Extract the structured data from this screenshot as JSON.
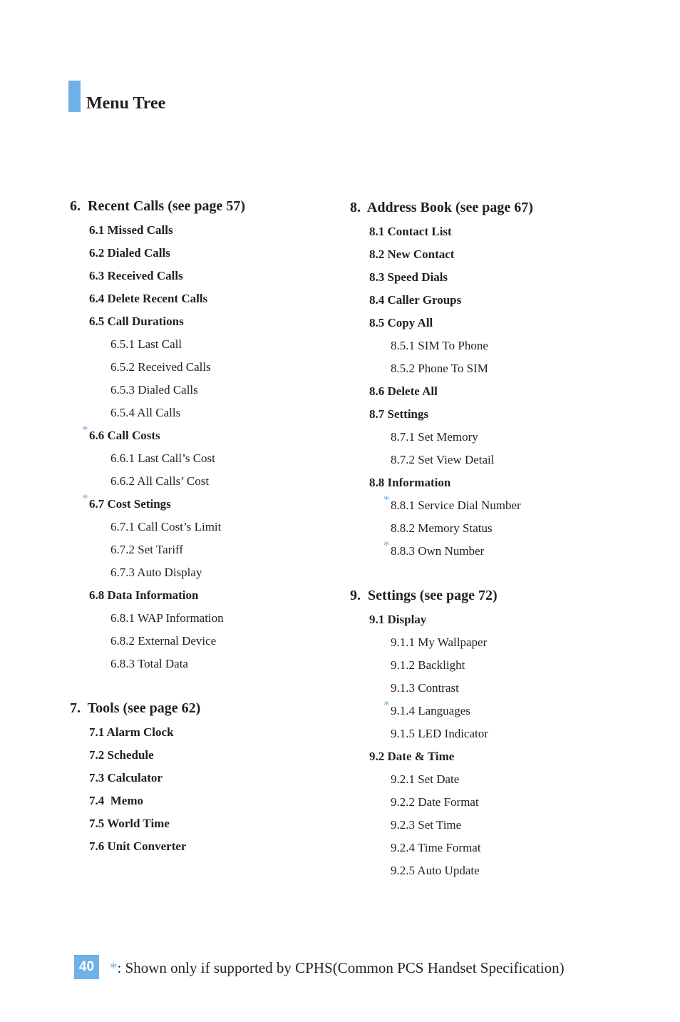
{
  "title": "Menu Tree",
  "colors": {
    "accent": "#6fb0e6",
    "text": "#231f20"
  },
  "left": {
    "s6": {
      "heading": "6.  Recent Calls (see page 57)",
      "items": [
        {
          "label": "6.1 Missed Calls",
          "level": 1,
          "cphs": false
        },
        {
          "label": "6.2 Dialed Calls",
          "level": 1,
          "cphs": false
        },
        {
          "label": "6.3 Received Calls",
          "level": 1,
          "cphs": false
        },
        {
          "label": "6.4 Delete Recent Calls",
          "level": 1,
          "cphs": false
        },
        {
          "label": "6.5 Call Durations",
          "level": 1,
          "cphs": false
        },
        {
          "label": "6.5.1 Last Call",
          "level": 2,
          "cphs": false
        },
        {
          "label": "6.5.2 Received Calls",
          "level": 2,
          "cphs": false
        },
        {
          "label": "6.5.3 Dialed Calls",
          "level": 2,
          "cphs": false
        },
        {
          "label": "6.5.4 All Calls",
          "level": 2,
          "cphs": false
        },
        {
          "label": "6.6 Call Costs",
          "level": 1,
          "cphs": true
        },
        {
          "label": "6.6.1 Last Call’s Cost",
          "level": 2,
          "cphs": false
        },
        {
          "label": "6.6.2 All Calls’ Cost",
          "level": 2,
          "cphs": false
        },
        {
          "label": "6.7 Cost Setings",
          "level": 1,
          "cphs": true
        },
        {
          "label": "6.7.1 Call Cost’s Limit",
          "level": 2,
          "cphs": false
        },
        {
          "label": "6.7.2 Set Tariff",
          "level": 2,
          "cphs": false
        },
        {
          "label": "6.7.3 Auto Display",
          "level": 2,
          "cphs": false
        },
        {
          "label": "6.8 Data Information",
          "level": 1,
          "cphs": false
        },
        {
          "label": "6.8.1 WAP Information",
          "level": 2,
          "cphs": false
        },
        {
          "label": "6.8.2 External Device",
          "level": 2,
          "cphs": false
        },
        {
          "label": "6.8.3 Total Data",
          "level": 2,
          "cphs": false
        }
      ]
    },
    "s7": {
      "heading": "7.  Tools (see page 62)",
      "items": [
        {
          "label": "7.1 Alarm Clock",
          "level": 1,
          "cphs": false
        },
        {
          "label": "7.2 Schedule",
          "level": 1,
          "cphs": false
        },
        {
          "label": "7.3 Calculator",
          "level": 1,
          "cphs": false
        },
        {
          "label": "7.4  Memo",
          "level": 1,
          "cphs": false
        },
        {
          "label": "7.5 World Time",
          "level": 1,
          "cphs": false
        },
        {
          "label": "7.6 Unit Converter",
          "level": 1,
          "cphs": false
        }
      ]
    }
  },
  "right": {
    "s8": {
      "heading": "8.  Address Book (see page 67)",
      "items": [
        {
          "label": "8.1 Contact List",
          "level": 1,
          "cphs": false
        },
        {
          "label": "8.2 New Contact",
          "level": 1,
          "cphs": false
        },
        {
          "label": "8.3 Speed Dials",
          "level": 1,
          "cphs": false
        },
        {
          "label": "8.4 Caller Groups",
          "level": 1,
          "cphs": false
        },
        {
          "label": "8.5 Copy All",
          "level": 1,
          "cphs": false
        },
        {
          "label": "8.5.1 SIM To Phone",
          "level": 2,
          "cphs": false
        },
        {
          "label": "8.5.2 Phone To SIM",
          "level": 2,
          "cphs": false
        },
        {
          "label": "8.6 Delete All",
          "level": 1,
          "cphs": false
        },
        {
          "label": "8.7 Settings",
          "level": 1,
          "cphs": false
        },
        {
          "label": "8.7.1 Set Memory",
          "level": 2,
          "cphs": false
        },
        {
          "label": "8.7.2 Set View Detail",
          "level": 2,
          "cphs": false
        },
        {
          "label": "8.8 Information",
          "level": 1,
          "cphs": false
        },
        {
          "label": "8.8.1 Service Dial Number",
          "level": 2,
          "cphs": true
        },
        {
          "label": "8.8.2 Memory Status",
          "level": 2,
          "cphs": false
        },
        {
          "label": "8.8.3 Own Number",
          "level": 2,
          "cphs": true
        }
      ]
    },
    "s9": {
      "heading": "9.  Settings (see page 72)",
      "items": [
        {
          "label": "9.1 Display",
          "level": 1,
          "cphs": false
        },
        {
          "label": "9.1.1 My Wallpaper",
          "level": 2,
          "cphs": false
        },
        {
          "label": "9.1.2 Backlight",
          "level": 2,
          "cphs": false
        },
        {
          "label": "9.1.3 Contrast",
          "level": 2,
          "cphs": false
        },
        {
          "label": "9.1.4 Languages",
          "level": 2,
          "cphs": true
        },
        {
          "label": "9.1.5 LED Indicator",
          "level": 2,
          "cphs": false
        },
        {
          "label": "9.2 Date & Time",
          "level": 1,
          "cphs": false
        },
        {
          "label": "9.2.1 Set Date",
          "level": 2,
          "cphs": false
        },
        {
          "label": "9.2.2 Date Format",
          "level": 2,
          "cphs": false
        },
        {
          "label": "9.2.3 Set Time",
          "level": 2,
          "cphs": false
        },
        {
          "label": "9.2.4 Time Format",
          "level": 2,
          "cphs": false
        },
        {
          "label": "9.2.5 Auto Update",
          "level": 2,
          "cphs": false
        }
      ]
    }
  },
  "footer": {
    "page_number": "40",
    "star_symbol": "*",
    "note": ": Shown only if supported by CPHS(Common PCS Handset Specification)"
  }
}
